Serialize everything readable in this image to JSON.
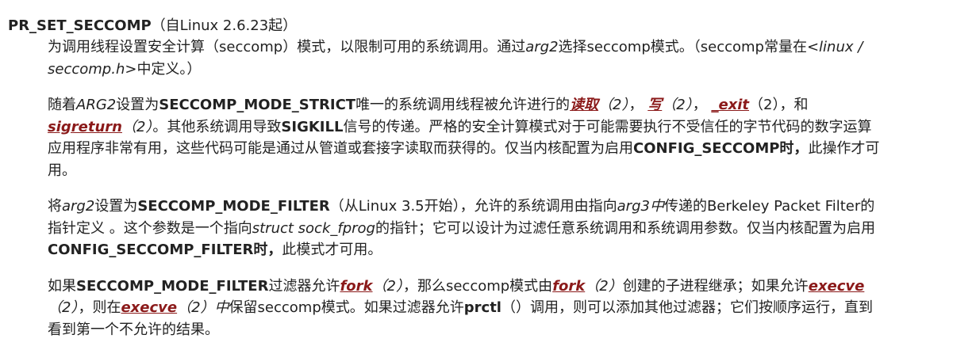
{
  "heading": {
    "name": "PR_SET_SECCOMP",
    "since": "（自Linux 2.6.23起）"
  },
  "p1": {
    "t1": "为调用线程设置安全计算（seccomp）模式，以限制可用的系统调用。通过",
    "arg2": "arg2",
    "t2": "选择seccomp模式。（seccomp常量在",
    "header_file": "<linux / seccomp.h>",
    "t3": "中定义。）"
  },
  "p2": {
    "t1": "随着",
    "arg2": "ARG2",
    "t2": "设置为",
    "mode_strict": "SECCOMP_MODE_STRICT",
    "t3": "唯一的系统调用线程被允许进行的",
    "read": "读取",
    "read_sec": "（2）",
    "sep1": "，",
    "write": "写",
    "write_sec": "（2）",
    "sep2": "，",
    "exit": "_exit",
    "exit_sec": "（2），和",
    "sigreturn": "sigreturn",
    "sigreturn_sec": "（2）",
    "t4": "。其他系统调用导致",
    "sigkill": "SIGKILL",
    "t5": "信号的传递。严格的安全计算模式对于可能需要执行不受信任的字节代码的数字运算应用程序非常有用，这些代码可能是通过从管道或套接字读取而获得的。仅当内核配置为启用",
    "config": "CONFIG_SECCOMP时，",
    "t6": "此操作才可用。"
  },
  "p3": {
    "t1": "将",
    "arg2": "arg2",
    "t2": "设置为",
    "mode_filter": "SECCOMP_MODE_FILTER",
    "t3": "（从Linux 3.5开始），允许的系统调用由指向",
    "arg3": "arg3中",
    "t4": "传递的Berkeley Packet Filter的指针定义 。这个参数是一个指向",
    "sock_fprog": "struct sock_fprog",
    "t5": "的指针；它可以设计为过滤任意系统调用和系统调用参数。仅当内核配置为启用",
    "config": "CONFIG_SECCOMP_FILTER时，",
    "t6": "此模式才可用。"
  },
  "p4": {
    "t1": "如果",
    "mode_filter": "SECCOMP_MODE_FILTER",
    "t2": "过滤器允许",
    "fork1": "fork",
    "fork1_sec": "（2）",
    "t3": "，那么seccomp模式由",
    "fork2": "fork",
    "fork2_sec": "（2）",
    "t4": "创建的子进程继承；如果允许",
    "execve1": "execve",
    "execve1_sec": "（2）",
    "t5": "，则在",
    "execve2": "execve",
    "execve2_sec": "（2）中",
    "t6": "保留seccomp模式。如果过滤器允许",
    "prctl": "prctl",
    "t7": "（）调用，则可以添加其他过滤器；它们按顺序运行，直到看到第一个不允许的结果。"
  },
  "colors": {
    "text": "#222222",
    "link": "#8b1a1a"
  }
}
